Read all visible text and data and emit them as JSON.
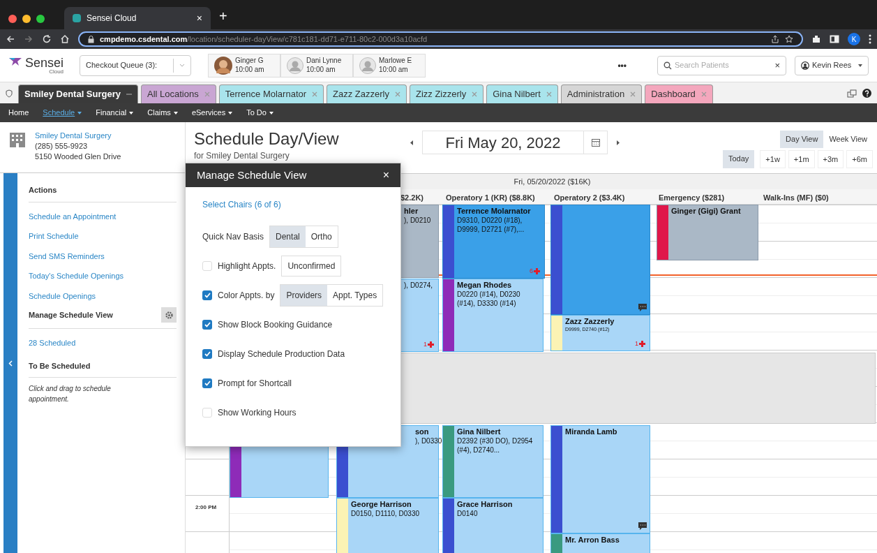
{
  "browser": {
    "tab_title": "Sensei Cloud",
    "tab_close": "×",
    "new_tab": "+",
    "url_host": "cmpdemo.csdental.com",
    "url_path": "/location/scheduler-dayView/c781c181-dd71-e711-80c2-000d3a10acfd",
    "profile_initial": "K"
  },
  "app_header": {
    "logo": "Sensei",
    "logo_sub": "Cloud",
    "checkout_queue": "Checkout Queue (3):",
    "patients": [
      {
        "name": "Ginger G",
        "time": "10:00 am",
        "kind": "photo"
      },
      {
        "name": "Dani Lynne",
        "time": "10:00 am",
        "kind": "avatar"
      },
      {
        "name": "Marlowe E",
        "time": "10:00 am",
        "kind": "avatar"
      }
    ],
    "more": "•••",
    "search": {
      "placeholder": "Search Patients",
      "clear": "×"
    },
    "user": "Kevin Rees"
  },
  "location_tabs": [
    {
      "label": "Smiley Dental Surgery",
      "color": "#3a3a3a",
      "selected": true
    },
    {
      "label": "All Locations",
      "color": "#c9a6d3",
      "selected": false
    },
    {
      "label": "Terrence Molarnator",
      "color": "#a9e4ec",
      "selected": false
    },
    {
      "label": "Zazz Zazzerly",
      "color": "#a9e4ec",
      "selected": false
    },
    {
      "label": "Zizz Zizzerly",
      "color": "#a9e4ec",
      "selected": false
    },
    {
      "label": "Gina Nilbert",
      "color": "#a9e4ec",
      "selected": false
    },
    {
      "label": "Administration",
      "color": "#d6d6d6",
      "selected": false
    },
    {
      "label": "Dashboard",
      "color": "#f4a7bd",
      "selected": false
    }
  ],
  "nav": [
    {
      "label": "Home",
      "selected": false,
      "menu": false
    },
    {
      "label": "Schedule",
      "selected": true,
      "menu": true
    },
    {
      "label": "Financial",
      "selected": false,
      "menu": true
    },
    {
      "label": "Claims",
      "selected": false,
      "menu": true
    },
    {
      "label": "eServices",
      "selected": false,
      "menu": true
    },
    {
      "label": "To Do",
      "selected": false,
      "menu": true
    }
  ],
  "location": {
    "name": "Smiley Dental Surgery",
    "phone": "(285) 555-9923",
    "address": "5150 Wooded Glen Drive"
  },
  "sidebar": {
    "actions_heading": "Actions",
    "actions": [
      "Schedule an Appointment",
      "Print Schedule",
      "Send SMS Reminders",
      "Today's Schedule Openings",
      "Schedule Openings"
    ],
    "manage_view": "Manage Schedule View",
    "scheduled": "28 Scheduled",
    "to_be_scheduled": "To Be Scheduled",
    "hint": "Click and drag to schedule appointment."
  },
  "schedule": {
    "title": "Schedule Day/View",
    "subtitle": "for Smiley Dental Surgery",
    "date": "Fri May 20, 2022",
    "views": [
      {
        "label": "Day View",
        "selected": true
      },
      {
        "label": "Week View",
        "selected": false
      }
    ],
    "today": "Today",
    "jumps": [
      "+1w",
      "+1m",
      "+3m",
      "+6m"
    ]
  },
  "grid": {
    "day_header": "Fri, 05/20/2022 ($16K)",
    "columns": [
      "$2.2K)",
      "Operatory 1 (KR) ($8.8K)",
      "Operatory 2 ($3.4K)",
      "Emergency ($281)",
      "Walk-Ins (MF) ($0)"
    ],
    "time_label": "2:00 PM",
    "appointments": [
      {
        "name": "hler",
        "codes": "), D0210",
        "kind": "gray"
      },
      {
        "codes": "), D0274,",
        "kind": "light",
        "badge": "1"
      },
      {
        "name": "Terrence Molarnator",
        "codes": "D9310, D0220 (#18), D9999, D2721 (#7),...",
        "kind": "dark",
        "color": "#3b4fd0",
        "badge": "6"
      },
      {
        "name": "Megan Rhodes",
        "codes": "D0220 (#14), D0230 (#14), D3330 (#14)",
        "kind": "light",
        "color": "#8e2bb8"
      },
      {
        "kind": "dark",
        "color": "#3b4fd0",
        "comment": true
      },
      {
        "name": "Zazz Zazzerly",
        "codes": "D9999, D2740 (#12)",
        "kind": "light",
        "color": "#fbf3b4",
        "badge": "1"
      },
      {
        "name": "Ginger (Gigi) Grant",
        "kind": "gray",
        "color": "#e0174a"
      },
      {
        "kind": "light",
        "color": "#8e2bb8"
      },
      {
        "name": "son",
        "codes": "), D0330",
        "kind": "light",
        "color": "#3b4fd0"
      },
      {
        "name": "Gina Nilbert",
        "codes": "D2392 (#30 DO), D2954 (#4), D2740...",
        "kind": "light",
        "color": "#3a9a80"
      },
      {
        "name": "Miranda Lamb",
        "kind": "light",
        "color": "#3b4fd0",
        "comment": true
      },
      {
        "name": "George Harrison",
        "codes": "D0150, D1110, D0330",
        "kind": "light",
        "color": "#fbf3b4"
      },
      {
        "name": "Grace Harrison",
        "codes": "D0140",
        "kind": "light",
        "color": "#3b4fd0"
      },
      {
        "name": "Mr. Arron Bass",
        "kind": "light",
        "color": "#3a9a80"
      }
    ]
  },
  "popup": {
    "title": "Manage Schedule View",
    "close": "×",
    "select_chairs": "Select Chairs (6 of 6)",
    "options": [
      {
        "kind": "segmented",
        "label": "Quick Nav Basis",
        "choices": [
          {
            "label": "Dental",
            "selected": true
          },
          {
            "label": "Ortho",
            "selected": false
          }
        ]
      },
      {
        "kind": "check_button",
        "label": "Highlight Appts.",
        "checked": false,
        "button": "Unconfirmed"
      },
      {
        "kind": "check_segmented",
        "label": "Color Appts. by",
        "checked": true,
        "choices": [
          {
            "label": "Providers",
            "selected": true
          },
          {
            "label": "Appt. Types",
            "selected": false
          }
        ]
      },
      {
        "kind": "checkbox",
        "label": "Show Block Booking Guidance",
        "checked": true
      },
      {
        "kind": "checkbox",
        "label": "Display Schedule Production Data",
        "checked": true
      },
      {
        "kind": "checkbox",
        "label": "Prompt for Shortcall",
        "checked": true
      },
      {
        "kind": "checkbox",
        "label": "Show Working Hours",
        "checked": false
      }
    ]
  }
}
